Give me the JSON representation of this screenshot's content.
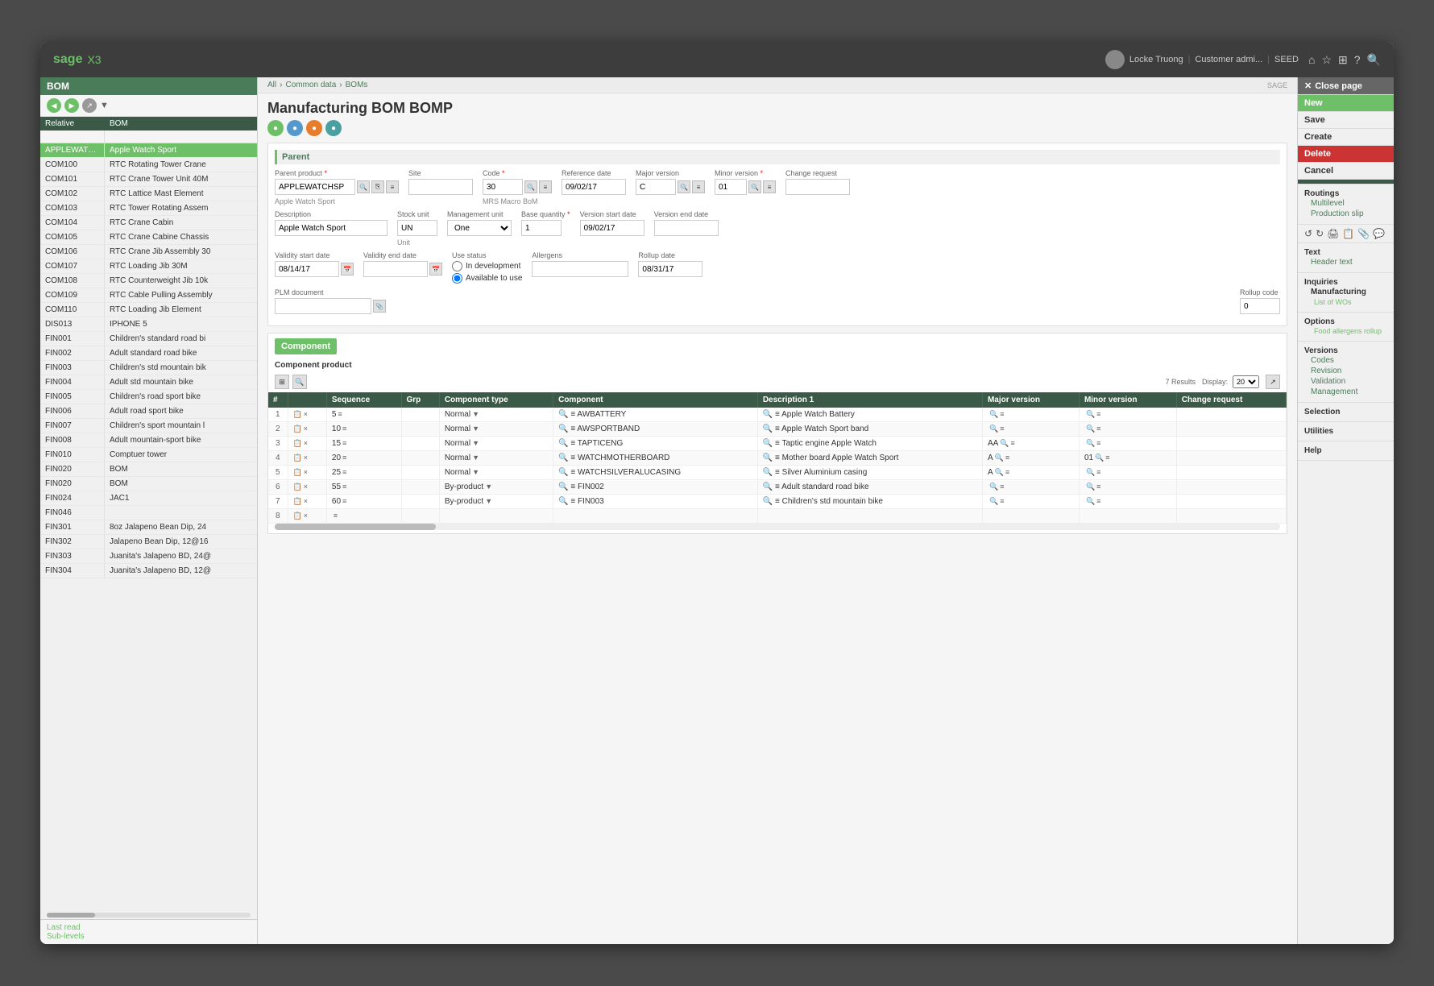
{
  "app": {
    "name": "sage",
    "version": "X3",
    "title": "Manufacturing BOM BOMP"
  },
  "topbar": {
    "user": "Locke Truong",
    "customer": "Customer admi...",
    "seed": "SEED"
  },
  "breadcrumb": {
    "all": "All",
    "common_data": "Common data",
    "boms": "BOMs"
  },
  "page_label": "BOM",
  "page_title": "Manufacturing BOM BOMP",
  "left_panel": {
    "header": "BOM",
    "columns": {
      "relative": "Relative",
      "bom": "BOM"
    },
    "items": [
      {
        "relative": "APPLEWATCHSP",
        "bom": "Apple Watch Sport",
        "active": true
      },
      {
        "relative": "COM100",
        "bom": "RTC Rotating Tower Crane"
      },
      {
        "relative": "COM101",
        "bom": "RTC Crane Tower Unit 40M"
      },
      {
        "relative": "COM102",
        "bom": "RTC Lattice Mast Element"
      },
      {
        "relative": "COM103",
        "bom": "RTC Tower Rotating Assem"
      },
      {
        "relative": "COM104",
        "bom": "RTC Crane Cabin"
      },
      {
        "relative": "COM105",
        "bom": "RTC Crane Cabine Chassis"
      },
      {
        "relative": "COM106",
        "bom": "RTC Crane Jib Assembly 30"
      },
      {
        "relative": "COM107",
        "bom": "RTC Loading Jib 30M"
      },
      {
        "relative": "COM108",
        "bom": "RTC Counterweight Jib 10k"
      },
      {
        "relative": "COM109",
        "bom": "RTC Cable Pulling Assembly"
      },
      {
        "relative": "COM110",
        "bom": "RTC Loading Jib Element"
      },
      {
        "relative": "DIS013",
        "bom": "IPHONE 5"
      },
      {
        "relative": "FIN001",
        "bom": "Children's standard road bi"
      },
      {
        "relative": "FIN002",
        "bom": "Adult standard road bike"
      },
      {
        "relative": "FIN003",
        "bom": "Children's std mountain bik"
      },
      {
        "relative": "FIN004",
        "bom": "Adult std mountain bike"
      },
      {
        "relative": "FIN005",
        "bom": "Children's road sport bike"
      },
      {
        "relative": "FIN006",
        "bom": "Adult road sport bike"
      },
      {
        "relative": "FIN007",
        "bom": "Children's sport mountain l"
      },
      {
        "relative": "FIN008",
        "bom": "Adult mountain-sport bike"
      },
      {
        "relative": "FIN010",
        "bom": "Comptuer tower"
      },
      {
        "relative": "FIN020",
        "bom": "BOM"
      },
      {
        "relative": "FIN020",
        "bom": "BOM"
      },
      {
        "relative": "FIN024",
        "bom": "JAC1"
      },
      {
        "relative": "FIN046",
        "bom": ""
      },
      {
        "relative": "FIN301",
        "bom": "8oz Jalapeno Bean Dip, 24"
      },
      {
        "relative": "FIN302",
        "bom": "Jalapeno Bean Dip, 12@16"
      },
      {
        "relative": "FIN303",
        "bom": "Juanita's Jalapeno BD, 24@"
      },
      {
        "relative": "FIN304",
        "bom": "Juanita's Jalapeno BD, 12@"
      }
    ],
    "last_read": "Last read",
    "sub_levels": "Sub-levels"
  },
  "parent_section": {
    "title": "Parent",
    "parent_product_label": "Parent product",
    "parent_product_value": "APPLEWATCHSP",
    "parent_product_hint": "Apple Watch Sport",
    "site_label": "Site",
    "site_value": "",
    "code_label": "Code",
    "code_value": "30",
    "code_hint": "MRS Macro BoM",
    "reference_date_label": "Reference date",
    "reference_date_value": "09/02/17",
    "major_version_label": "Major version",
    "major_version_value": "C",
    "minor_version_label": "Minor version",
    "minor_version_value": "01",
    "change_request_label": "Change request",
    "change_request_value": "",
    "description_label": "Description",
    "description_value": "Apple Watch Sport",
    "stock_unit_label": "Stock unit",
    "stock_unit_value": "UN",
    "stock_unit_hint": "Unit",
    "management_unit_label": "Management unit",
    "management_unit_value": "One",
    "base_quantity_label": "Base quantity",
    "base_quantity_value": "1",
    "version_start_date_label": "Version start date",
    "version_start_date_value": "09/02/17",
    "version_end_date_label": "Version end date",
    "version_end_date_value": "",
    "validity_start_date_label": "Validity start date",
    "validity_start_date_value": "08/14/17",
    "validity_end_date_label": "Validity end date",
    "validity_end_date_value": "",
    "use_status_label": "Use status",
    "use_status_option1": "In development",
    "use_status_option2": "Available to use",
    "allergens_label": "Allergens",
    "allergens_value": "",
    "plm_document_label": "PLM document",
    "rollup_date_label": "Rollup date",
    "rollup_date_value": "08/31/17",
    "rollup_code_label": "Rollup code",
    "rollup_code_value": "0"
  },
  "component_section": {
    "title": "Component",
    "product_label": "Component product",
    "results_label": "7 Results",
    "display_label": "Display:",
    "display_value": "20",
    "columns": {
      "seq": "#",
      "icons": "",
      "sequence": "Sequence",
      "grp": "Grp",
      "component_type": "Component type",
      "component": "Component",
      "description1": "Description 1",
      "major_version": "Major version",
      "minor_version": "Minor version",
      "change_request": "Change request"
    },
    "rows": [
      {
        "num": "1",
        "sequence": "5",
        "grp": "",
        "component_type": "Normal",
        "component": "AWBATTERY",
        "description1": "Apple Watch Battery",
        "major_version": "",
        "minor_version": "",
        "change_request": ""
      },
      {
        "num": "2",
        "sequence": "10",
        "grp": "",
        "component_type": "Normal",
        "component": "AWSPORTBAND",
        "description1": "Apple Watch Sport band",
        "major_version": "",
        "minor_version": "",
        "change_request": ""
      },
      {
        "num": "3",
        "sequence": "15",
        "grp": "",
        "component_type": "Normal",
        "component": "TAPTICENG",
        "description1": "Taptic engine Apple Watch",
        "major_version": "AA",
        "minor_version": "",
        "change_request": ""
      },
      {
        "num": "4",
        "sequence": "20",
        "grp": "",
        "component_type": "Normal",
        "component": "WATCHMOTHERBOARD",
        "description1": "Mother board Apple Watch Sport",
        "major_version": "A",
        "minor_version": "01",
        "change_request": ""
      },
      {
        "num": "5",
        "sequence": "25",
        "grp": "",
        "component_type": "Normal",
        "component": "WATCHSILVERALUCASING",
        "description1": "Silver Aluminium casing",
        "major_version": "A",
        "minor_version": "",
        "change_request": ""
      },
      {
        "num": "6",
        "sequence": "55",
        "grp": "",
        "component_type": "By-product",
        "component": "FIN002",
        "description1": "Adult standard road bike",
        "major_version": "",
        "minor_version": "",
        "change_request": ""
      },
      {
        "num": "7",
        "sequence": "60",
        "grp": "",
        "component_type": "By-product",
        "component": "FIN003",
        "description1": "Children's std mountain bike",
        "major_version": "",
        "minor_version": "",
        "change_request": ""
      },
      {
        "num": "8",
        "sequence": "",
        "grp": "",
        "component_type": "",
        "component": "",
        "description1": "",
        "major_version": "",
        "minor_version": "",
        "change_request": ""
      }
    ]
  },
  "right_panel": {
    "close_label": "Close page",
    "new_label": "New",
    "save_label": "Save",
    "create_label": "Create",
    "delete_label": "Delete",
    "cancel_label": "Cancel",
    "routings_label": "Routings",
    "multilevel_label": "Multilevel",
    "production_slip_label": "Production slip",
    "text_label": "Text",
    "header_text_label": "Header text",
    "inquiries_label": "Inquiries",
    "manufacturing_label": "Manufacturing",
    "list_of_wos_label": "List of WOs",
    "options_label": "Options",
    "food_allergens_rollup": "Food allergens rollup",
    "versions_label": "Versions",
    "codes_label": "Codes",
    "revision_label": "Revision",
    "validation_label": "Validation",
    "management_label": "Management",
    "selection_label": "Selection",
    "utilities_label": "Utilities",
    "help_label": "Help"
  }
}
